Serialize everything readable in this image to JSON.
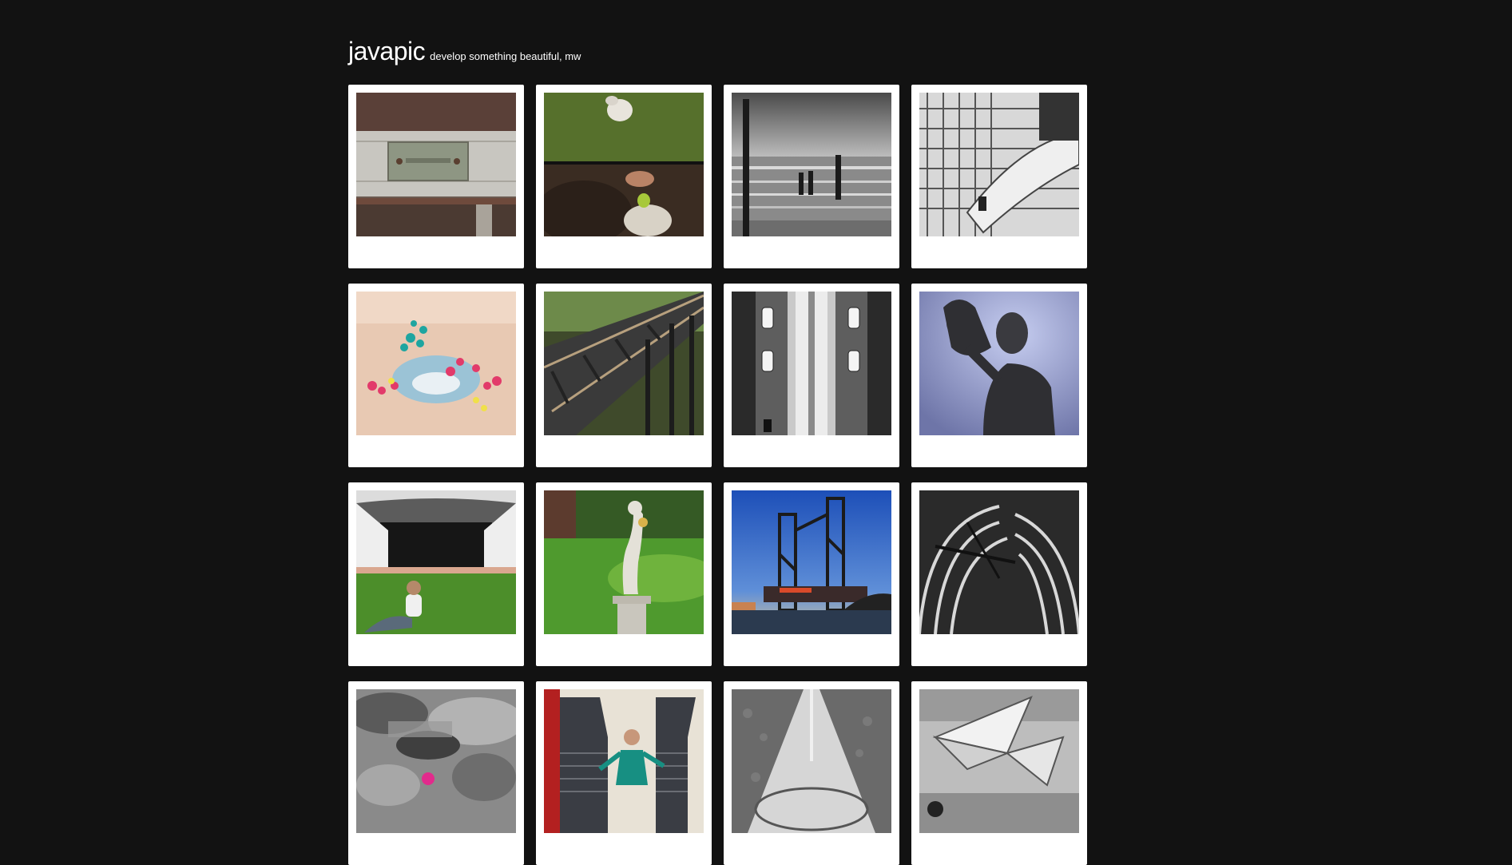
{
  "site": {
    "title": "javapic",
    "tagline": "develop something beautiful, mw"
  },
  "photos": [
    {
      "icon": "rusty-nameplate-photo"
    },
    {
      "icon": "dog-toy-photo"
    },
    {
      "icon": "beach-pilings-photo"
    },
    {
      "icon": "hangar-airplane-photo"
    },
    {
      "icon": "painted-toes-photo"
    },
    {
      "icon": "railway-trestle-photo"
    },
    {
      "icon": "aerial-street-cars-photo"
    },
    {
      "icon": "mother-child-statue-photo"
    },
    {
      "icon": "girl-amphitheater-photo"
    },
    {
      "icon": "garden-statue-photo"
    },
    {
      "icon": "lift-bridge-photo"
    },
    {
      "icon": "cathedral-arches-photo"
    },
    {
      "icon": "stone-texture-photo"
    },
    {
      "icon": "girl-columns-photo"
    },
    {
      "icon": "pavement-path-photo"
    },
    {
      "icon": "paper-plane-sculpture-photo"
    }
  ]
}
